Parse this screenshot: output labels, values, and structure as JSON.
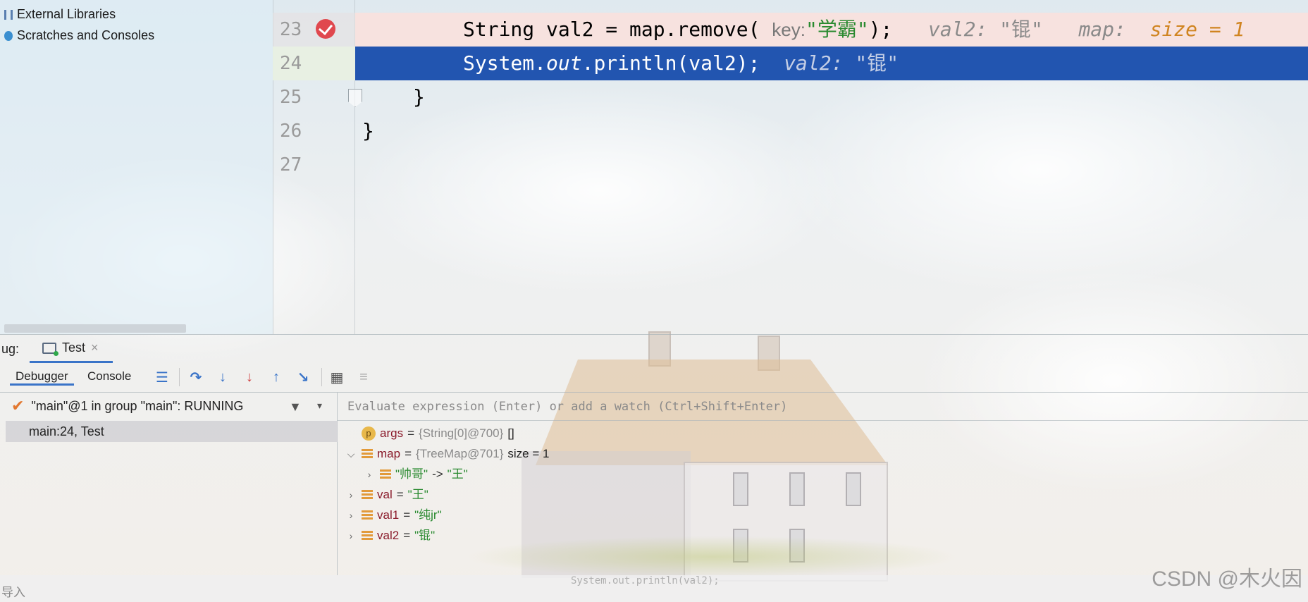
{
  "project": {
    "items": [
      {
        "label": "External Libraries",
        "icon": "library-icon"
      },
      {
        "label": "Scratches and Consoles",
        "icon": "scratch-icon"
      }
    ]
  },
  "editor": {
    "lines": [
      {
        "num": "23",
        "breakpoint": true
      },
      {
        "num": "24",
        "current": true
      },
      {
        "num": "25"
      },
      {
        "num": "26"
      },
      {
        "num": "27"
      }
    ],
    "line23": {
      "code_prefix": "String val2 = map.remove(",
      "hint_key": "key:",
      "arg": "\"学霸\"",
      "code_suffix": ");",
      "inline_val2_name": "val2:",
      "inline_val2_value": "\"锟\"",
      "inline_map_name": "map:",
      "inline_map_value": "size = 1"
    },
    "line24": {
      "code_prefix": "System.",
      "code_italic": "out",
      "code_suffix": ".println(val2);",
      "inline_name": "val2:",
      "inline_value": "\"锟\""
    },
    "line25": {
      "code": "}"
    },
    "line26": {
      "code": "}"
    }
  },
  "debug": {
    "label": "ug:",
    "run_tab": "Test",
    "tab_close": "×",
    "tabs": [
      "Debugger",
      "Console"
    ]
  },
  "threads": {
    "thread": "\"main\"@1 in group \"main\": RUNNING",
    "frame": "main:24, Test"
  },
  "variables": {
    "eval_placeholder": "Evaluate expression (Enter) or add a watch (Ctrl+Shift+Enter)",
    "args": {
      "name": "args",
      "eq": "=",
      "ref": "{String[0]@700}",
      "value": "[]"
    },
    "map": {
      "name": "map",
      "eq": "=",
      "ref": "{TreeMap@701}",
      "value": "size = 1"
    },
    "map_entry": {
      "key": "\"帅哥\"",
      "arrow": "->",
      "value": "\"王\""
    },
    "val": {
      "name": "val",
      "eq": "=",
      "value": "\"王\""
    },
    "val1": {
      "name": "val1",
      "eq": "=",
      "value": "\"纯jr\""
    },
    "val2": {
      "name": "val2",
      "eq": "=",
      "value": "\"锟\""
    }
  },
  "status": {
    "left": "导入",
    "mid": "System.out.println(val2);"
  },
  "watermark": "CSDN @木火因",
  "colors": {
    "exec_line": "#2255b0",
    "breakpoint": "#e0484e",
    "string": "#2a8a30",
    "accent": "#3a74c8"
  }
}
